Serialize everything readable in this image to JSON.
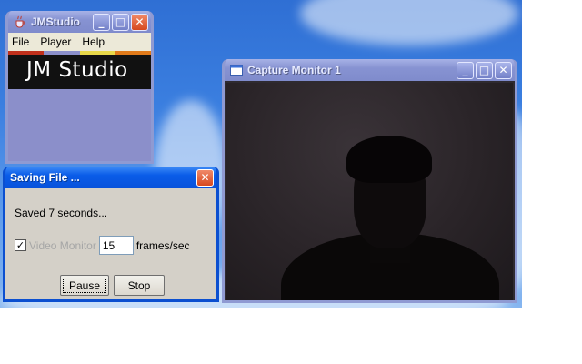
{
  "jmstudio": {
    "title": "JMStudio",
    "menu": [
      "File",
      "Player",
      "Help"
    ],
    "logo_text": "JM Studio",
    "stripe_colors": [
      "#c0301c",
      "#8b8fca",
      "#e8d84a",
      "#e07a1a"
    ]
  },
  "capture_monitor": {
    "title": "Capture Monitor 1"
  },
  "saving_dialog": {
    "title": "Saving File ...",
    "status": "Saved 7 seconds...",
    "video_monitor_label": "Video Monitor",
    "video_monitor_checked": true,
    "frame_rate_value": "15",
    "frame_rate_unit": "frames/sec",
    "pause_label": "Pause",
    "stop_label": "Stop"
  },
  "window_controls": {
    "minimize": "_",
    "maximize": "□",
    "close": "✕"
  }
}
